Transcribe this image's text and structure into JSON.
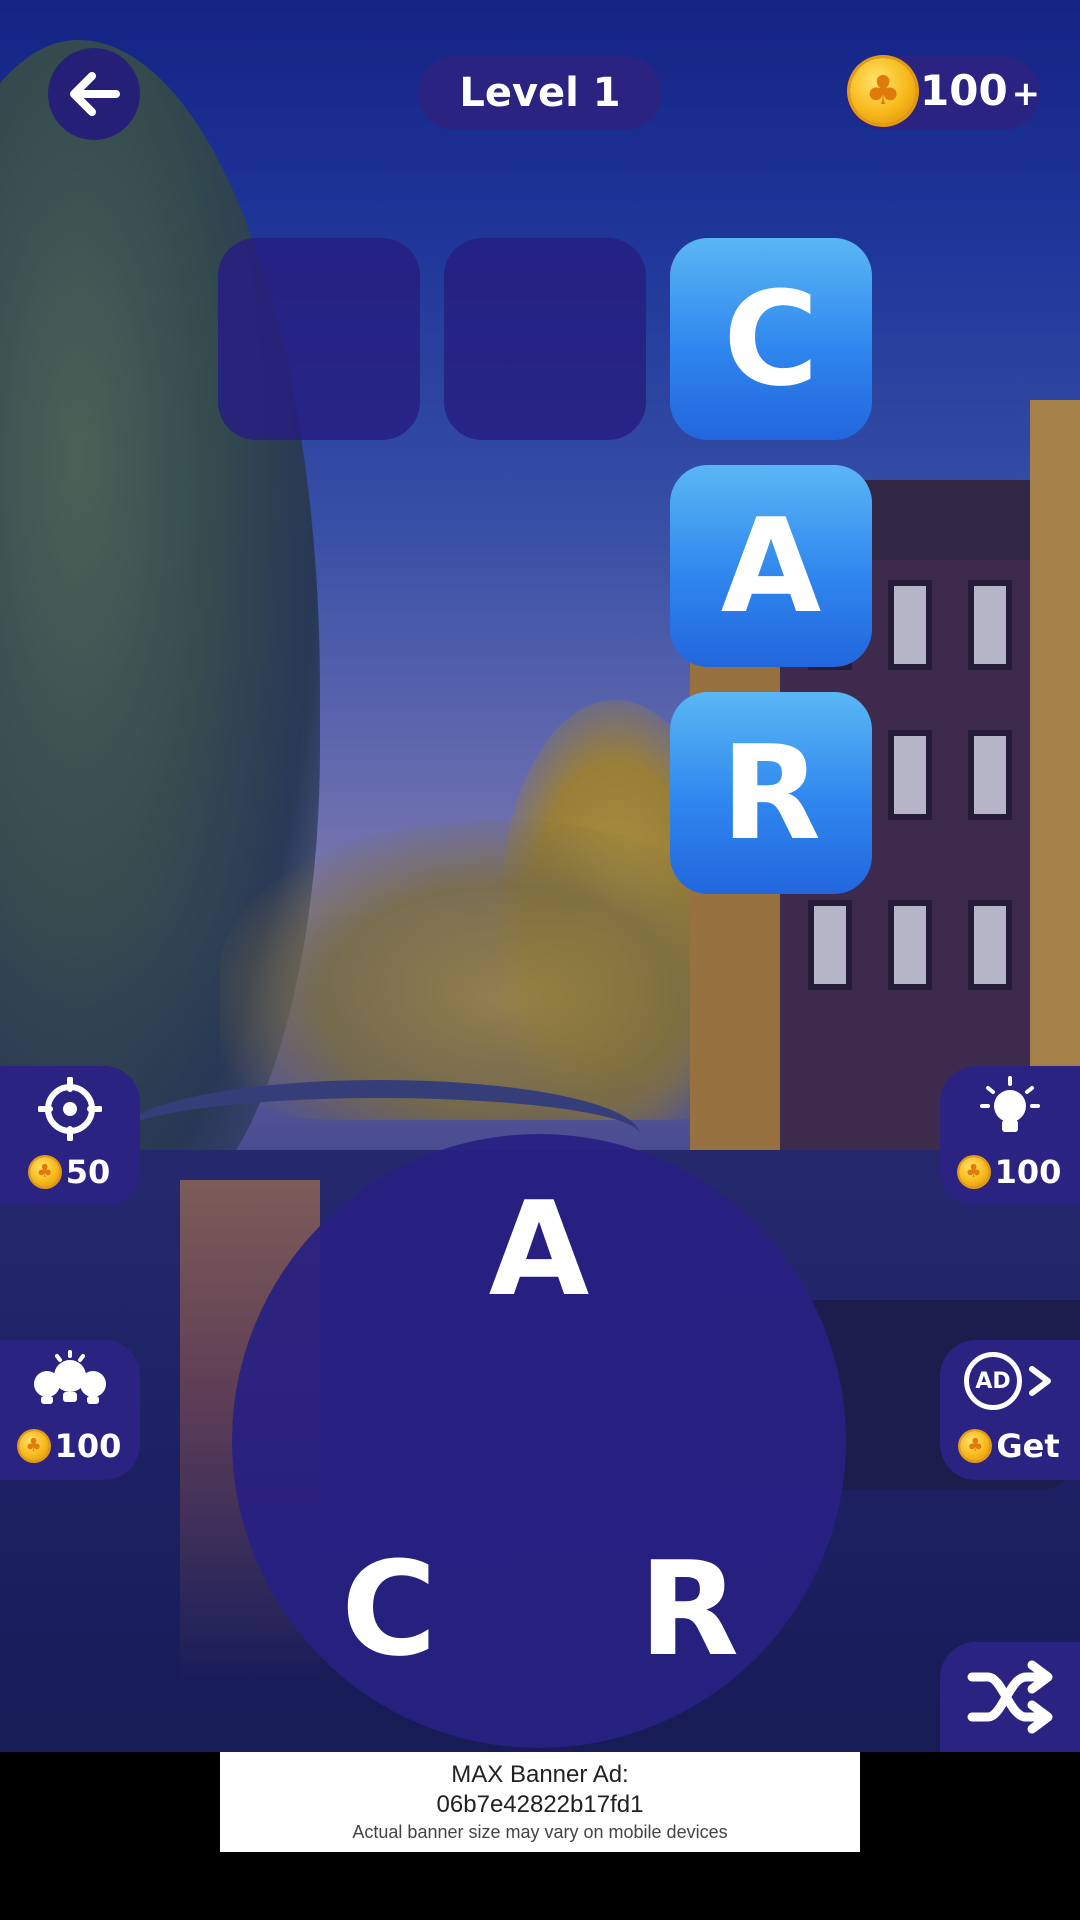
{
  "header": {
    "level_label": "Level 1",
    "coins": "100",
    "coins_plus": "+"
  },
  "word_grid": {
    "cells": [
      {
        "letter": "",
        "state": "empty"
      },
      {
        "letter": "",
        "state": "empty"
      },
      {
        "letter": "C",
        "state": "revealed"
      },
      {
        "letter": "A",
        "state": "revealed"
      },
      {
        "letter": "R",
        "state": "revealed"
      }
    ]
  },
  "powerups": {
    "target": {
      "icon": "target-crosshair-icon",
      "cost": "50"
    },
    "hint": {
      "icon": "lightbulb-icon",
      "cost": "100"
    },
    "multi_hint": {
      "icon": "multi-lightbulb-icon",
      "cost": "100"
    },
    "ad_reward": {
      "icon": "ad-play-icon",
      "ad_label": "AD",
      "label": "Get"
    },
    "shuffle": {
      "icon": "shuffle-icon"
    }
  },
  "wheel": {
    "letters": [
      "A",
      "C",
      "R"
    ]
  },
  "ad_banner": {
    "line1": "MAX Banner Ad:",
    "line2": "06b7e42822b17fd1",
    "note": "Actual banner size may vary on mobile devices"
  },
  "colors": {
    "panel": "#2a2382",
    "tile_blue": "#2f86ee",
    "coin_gold": "#f7b81a"
  }
}
